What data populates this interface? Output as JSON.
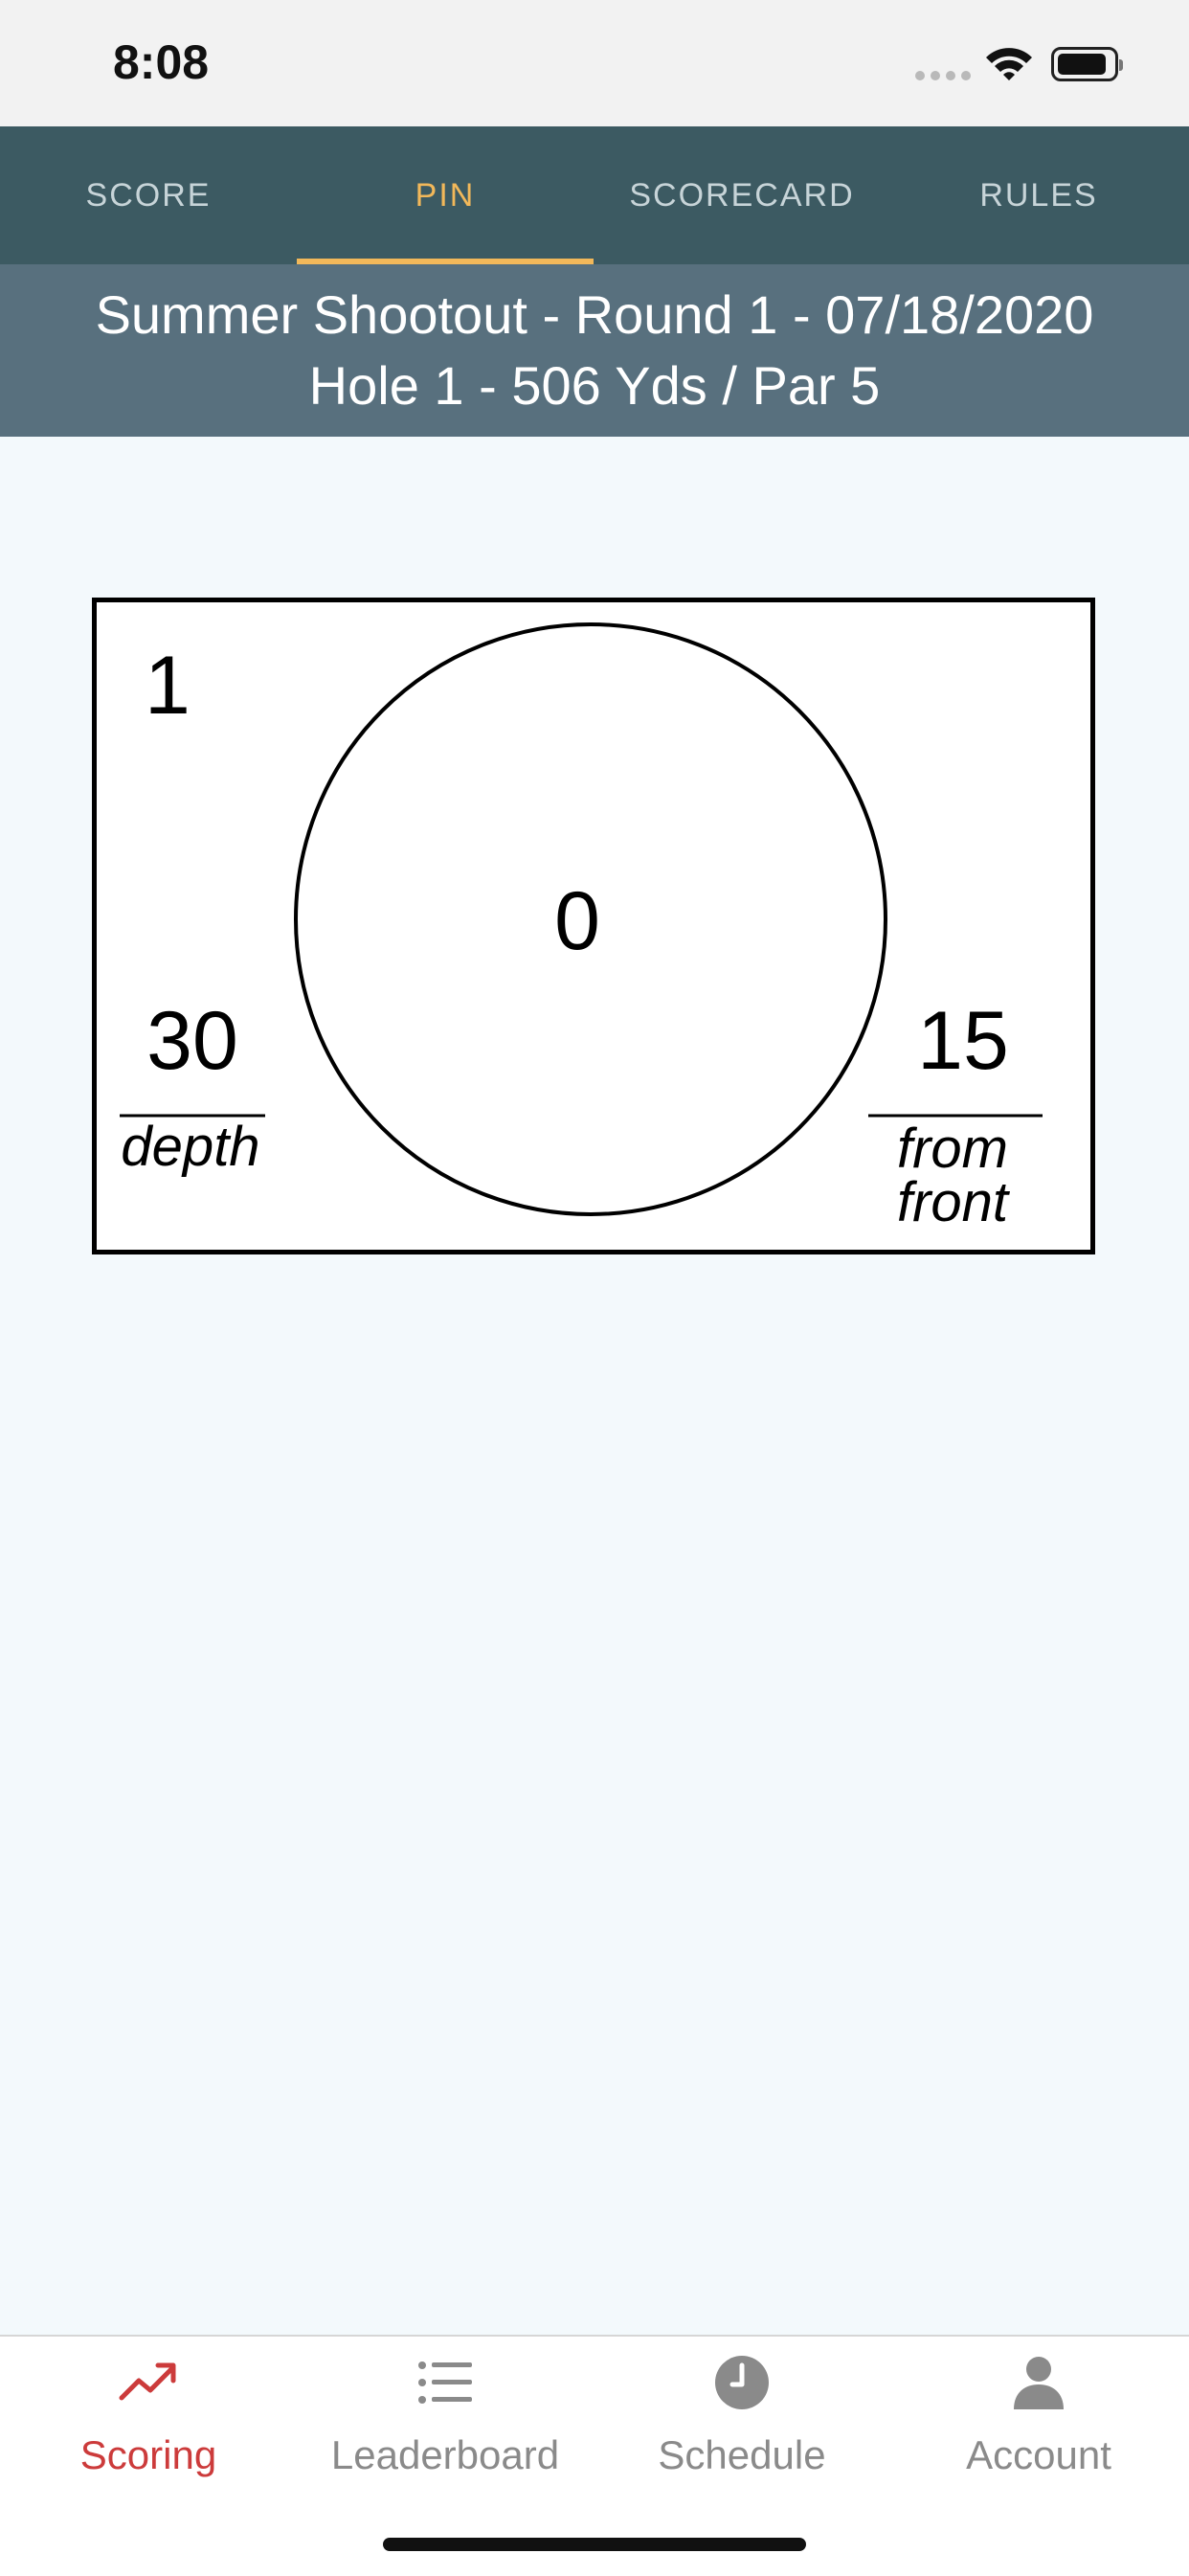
{
  "status_bar": {
    "time": "8:08"
  },
  "top_tabs": {
    "items": [
      {
        "label": "SCORE"
      },
      {
        "label": "PIN"
      },
      {
        "label": "SCORECARD"
      },
      {
        "label": "RULES"
      }
    ],
    "active": "PIN"
  },
  "header": {
    "line1": "Summer Shootout - Round 1 - 07/18/2020",
    "line2": "Hole 1 - 506 Yds / Par 5"
  },
  "pin_sheet": {
    "hole_number": "1",
    "center_value": "0",
    "depth_value": "30",
    "depth_label": "depth",
    "from_front_value": "15",
    "from_front_label_1": "from",
    "from_front_label_2": "front"
  },
  "bottom_tabs": {
    "items": [
      {
        "label": "Scoring",
        "icon": "trend-icon"
      },
      {
        "label": "Leaderboard",
        "icon": "list-icon"
      },
      {
        "label": "Schedule",
        "icon": "clock-icon"
      },
      {
        "label": "Account",
        "icon": "person-icon"
      }
    ],
    "active": "Scoring",
    "active_color": "#cc3b3b",
    "inactive_color": "#8a8a8a"
  },
  "colors": {
    "tabs_background": "#3c5a62",
    "active_tab": "#f2b85a",
    "header_background": "#58707e",
    "page_background": "#f3f9fc"
  }
}
